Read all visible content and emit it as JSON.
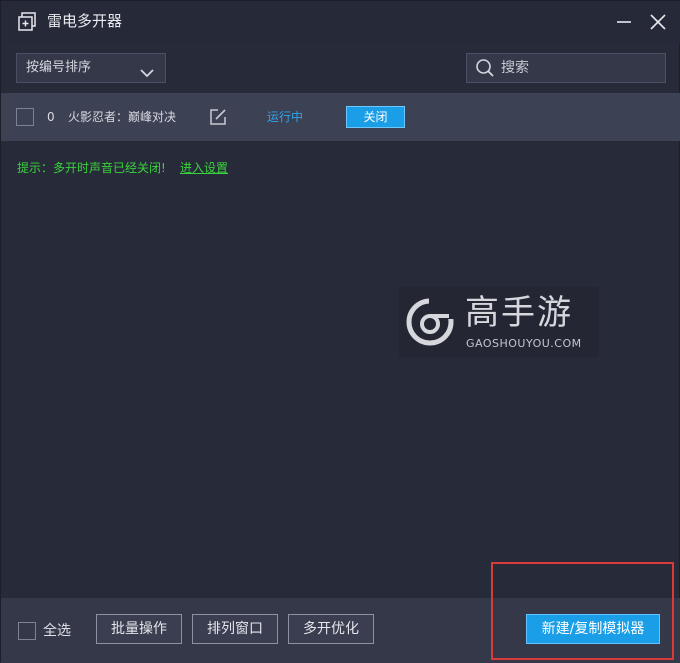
{
  "window": {
    "title": "雷电多开器"
  },
  "toolbar": {
    "sort_label": "按编号排序",
    "search_placeholder": "搜索"
  },
  "instances": [
    {
      "index": "0",
      "name": "火影忍者：巅峰对决",
      "status": "运行中",
      "close_label": "关闭"
    }
  ],
  "hint": {
    "text": "提示：多开时声音已经关闭!",
    "link": "进入设置"
  },
  "watermark": {
    "text": "高手游",
    "sub": "GAOSHOUYOU.COM"
  },
  "bottom": {
    "select_all": "全选",
    "batch": "批量操作",
    "arrange": "排列窗口",
    "optimize": "多开优化",
    "new_copy": "新建/复制模拟器"
  },
  "colors": {
    "background": "#272a39",
    "row": "#3d4154",
    "accent": "#1a9ee8",
    "status_blue": "#2fa4e7",
    "hint_green": "#39d33b",
    "highlight_red": "#d93a3a"
  },
  "icons": [
    "app-plus-icon",
    "minimize-icon",
    "close-icon",
    "chevron-down-icon",
    "search-icon",
    "edit-icon",
    "watermark-logo"
  ]
}
